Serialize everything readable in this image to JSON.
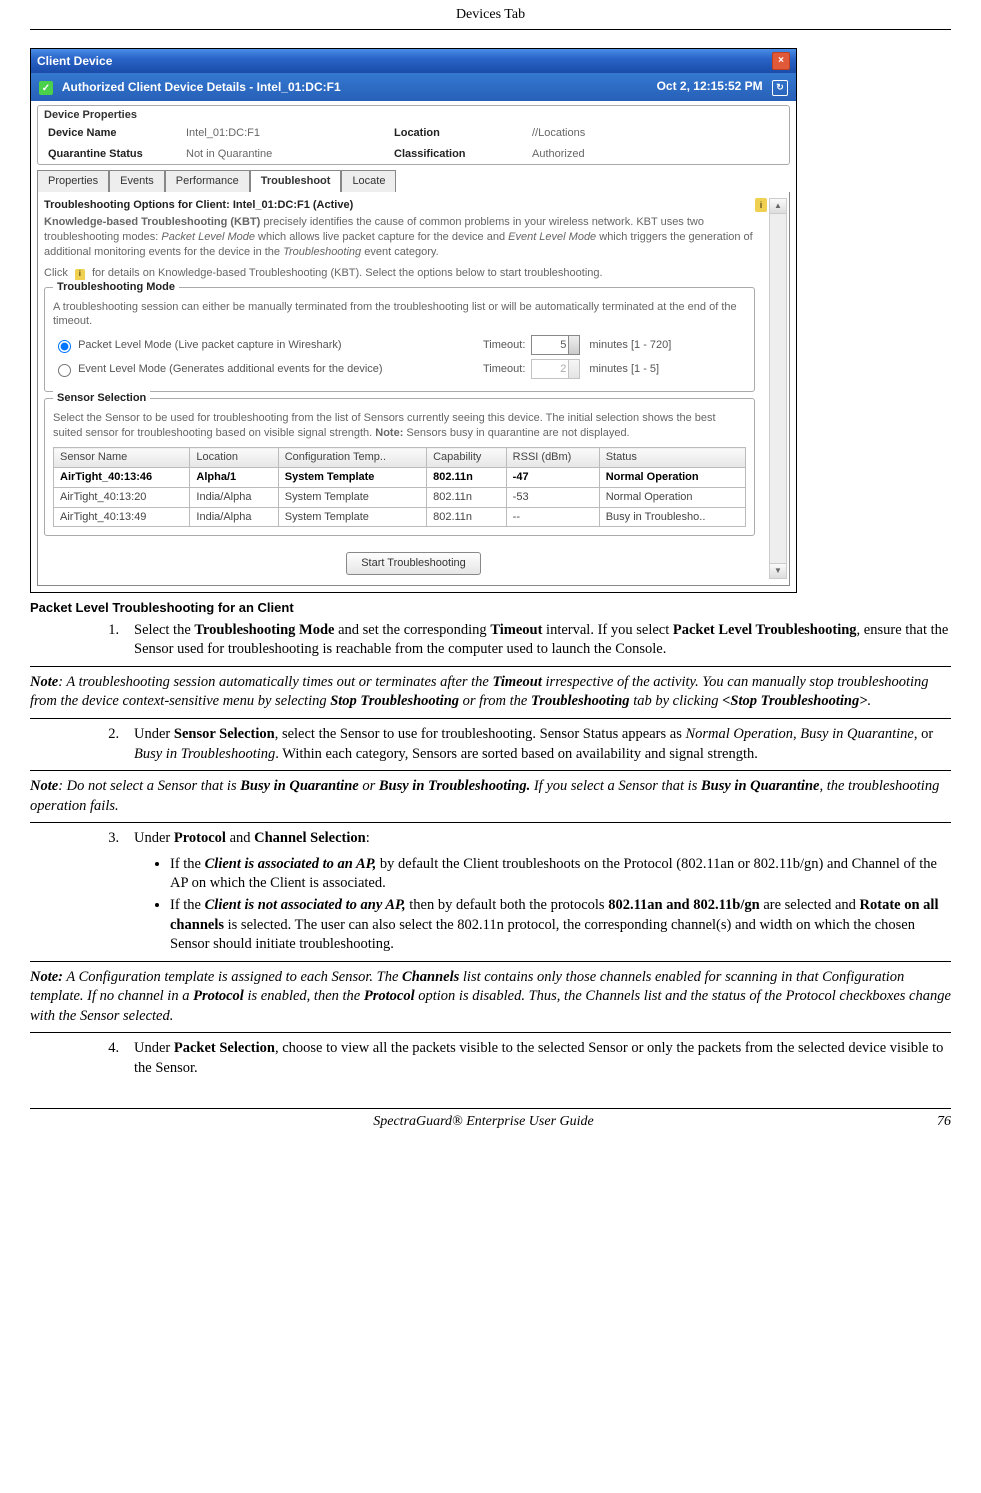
{
  "header": {
    "title": "Devices Tab"
  },
  "footer": {
    "guide": "SpectraGuard® Enterprise User Guide",
    "page": "76"
  },
  "window": {
    "titlebar": "Client Device",
    "subtitle_prefix": "Authorized Client Device Details  -  ",
    "subtitle_device": "Intel_01:DC:F1",
    "timestamp": "Oct 2, 12:15:52 PM",
    "properties": {
      "section_label": "Device Properties",
      "rows": [
        {
          "l1": "Device Name",
          "v1": "Intel_01:DC:F1",
          "l2": "Location",
          "v2": "//Locations"
        },
        {
          "l1": "Quarantine Status",
          "v1": "Not in Quarantine",
          "l2": "Classification",
          "v2": "Authorized"
        }
      ]
    },
    "tabs": [
      "Properties",
      "Events",
      "Performance",
      "Troubleshoot",
      "Locate"
    ],
    "troubleshoot": {
      "heading": "Troubleshooting Options for  Client:  Intel_01:DC:F1 (Active)",
      "kbt_para": "Knowledge-based Troubleshooting (KBT) precisely identifies the cause of common problems in your wireless network. KBT uses two troubleshooting modes: Packet Level Mode which allows live packet capture for the device and Event Level Mode which triggers the generation of additional monitoring events for the device in the Troubleshooting event category.",
      "click_line_a": "Click",
      "click_line_b": "for details on Knowledge-based Troubleshooting (KBT). Select the options below to start troubleshooting.",
      "mode": {
        "legend": "Troubleshooting Mode",
        "desc": "A troubleshooting session can either be manually terminated from the troubleshooting list or will be automatically terminated at the end of the timeout.",
        "opt1": "Packet Level Mode (Live packet capture in Wireshark)",
        "opt2": "Event Level Mode (Generates additional events for the device)",
        "timeout_label": "Timeout:",
        "t1_val": "5",
        "t1_suffix": "minutes   [1 - 720]",
        "t2_val": "2",
        "t2_suffix": "minutes   [1 - 5]"
      },
      "sensor": {
        "legend": "Sensor Selection",
        "desc": "Select the Sensor to be used for troubleshooting from the list of Sensors currently seeing this device. The initial selection shows the best suited sensor for troubleshooting based on visible signal strength. Note: Sensors busy in quarantine are not displayed.",
        "cols": [
          "Sensor Name",
          "Location",
          "Configuration Temp..",
          "Capability",
          "RSSI (dBm)",
          "Status"
        ],
        "rows": [
          [
            "AirTight_40:13:46",
            "Alpha/1",
            "System Template",
            "802.11n",
            "-47",
            "Normal Operation"
          ],
          [
            "AirTight_40:13:20",
            "India/Alpha",
            "System Template",
            "802.11n",
            "-53",
            "Normal Operation"
          ],
          [
            "AirTight_40:13:49",
            "India/Alpha",
            "System Template",
            "802.11n",
            "--",
            "Busy in Troublesho.."
          ]
        ]
      },
      "start_button": "Start Troubleshooting"
    }
  },
  "doc": {
    "caption": "Packet Level Troubleshooting for an Client",
    "step1_a": "Select the ",
    "step1_b": "Troubleshooting Mode",
    "step1_c": " and set the corresponding ",
    "step1_d": "Timeout",
    "step1_e": " interval. If you select ",
    "step1_f": "Packet Level Troubleshooting",
    "step1_g": ", ensure that the Sensor used for troubleshooting is reachable from the computer used to launch the Console.",
    "note1_a": "Note",
    "note1_b": ": A troubleshooting session automatically times out or terminates after the ",
    "note1_c": "Timeout",
    "note1_d": " irrespective of the activity. You can manually stop troubleshooting from the device context-sensitive menu by selecting ",
    "note1_e": "Stop Troubleshooting",
    "note1_f": " or from the ",
    "note1_g": "Troubleshooting",
    "note1_h": " tab by clicking ",
    "note1_i": "<Stop Troubleshooting>",
    "note1_j": ".",
    "step2_a": "Under ",
    "step2_b": "Sensor Selection",
    "step2_c": ", select the Sensor to use for troubleshooting. Sensor Status appears as ",
    "step2_d": "Normal Operation",
    "step2_e": ", ",
    "step2_f": "Busy in Quarantine",
    "step2_g": ", or ",
    "step2_h": "Busy in Troubleshooting",
    "step2_i": ". Within each category, Sensors are sorted based on availability and signal strength.",
    "note2_a": "Note",
    "note2_b": ": Do not select a Sensor that is ",
    "note2_c": "Busy in Quarantine",
    "note2_d": " or ",
    "note2_e": "Busy in Troubleshooting.",
    "note2_f": " If you select a Sensor that is ",
    "note2_g": "Busy in Quarantine",
    "note2_h": ", the troubleshooting operation fails.",
    "step3_a": "Under ",
    "step3_b": "Protocol",
    "step3_c": " and ",
    "step3_d": "Channel Selection",
    "step3_e": ":",
    "b1_a": "If the ",
    "b1_b": "Client is associated to an AP,",
    "b1_c": " by default the Client troubleshoots on the Protocol (802.11an or 802.11b/gn) and Channel of the AP on which the Client is associated.",
    "b2_a": "If the ",
    "b2_b": "Client is not associated to any AP,",
    "b2_c": " then by default both the protocols ",
    "b2_d": "802.11an and 802.11b/gn",
    "b2_e": " are selected and ",
    "b2_f": "Rotate on all channels",
    "b2_g": " is selected. The user can also select the 802.11n protocol, the corresponding channel(s) and width on which the chosen Sensor should initiate troubleshooting.",
    "note3_a": "Note:",
    "note3_b": " A Configuration template is assigned to each Sensor. The ",
    "note3_c": "Channels",
    "note3_d": " list contains only those channels enabled for scanning in that Configuration template. If no channel in a ",
    "note3_e": "Protocol",
    "note3_f": " is enabled, then the ",
    "note3_g": "Protocol",
    "note3_h": " option is disabled. Thus, the Channels list and the status of the Protocol checkboxes change with the Sensor selected.",
    "step4_a": "Under ",
    "step4_b": "Packet Selection",
    "step4_c": ", choose to view all the packets visible to the selected Sensor or only the packets from the selected device visible to the Sensor."
  }
}
